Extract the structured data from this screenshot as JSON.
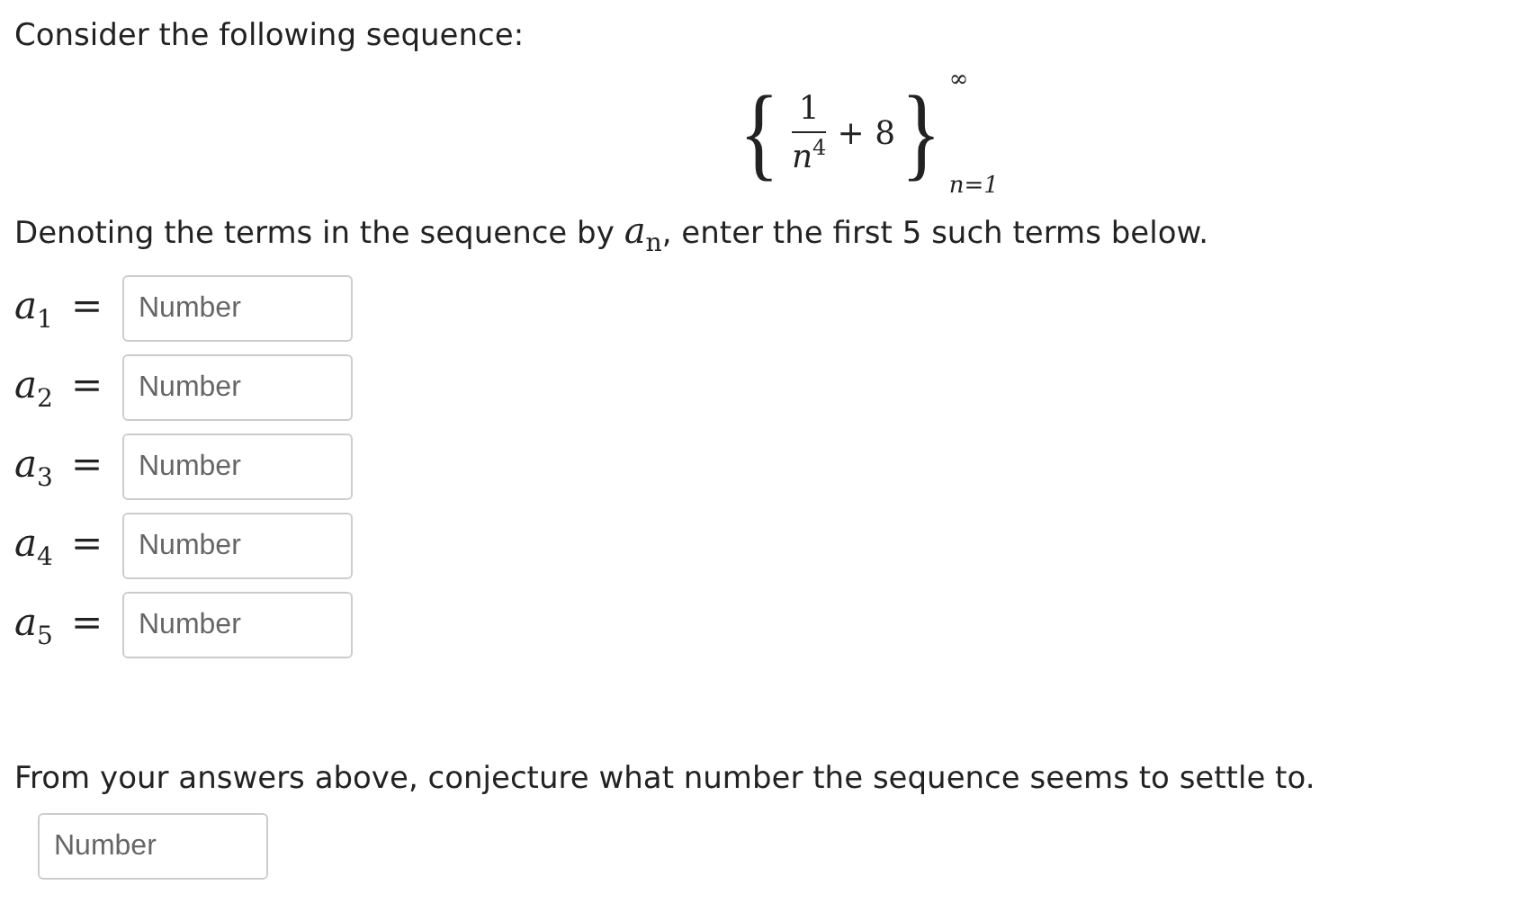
{
  "intro": "Consider the following sequence:",
  "formula": {
    "open": "{",
    "numerator": "1",
    "denominator_base": "n",
    "denominator_exp": "4",
    "addend": "+ 8",
    "close": "}",
    "upper": "∞",
    "lower": "n=1"
  },
  "instruction": "Denoting the terms in the sequence by *a*$_{n}$, enter the first 5 such terms below.",
  "terms": [
    {
      "symbol": "a",
      "index": "1",
      "equals": "=",
      "placeholder": "Number"
    },
    {
      "symbol": "a",
      "index": "2",
      "equals": "=",
      "placeholder": "Number"
    },
    {
      "symbol": "a",
      "index": "3",
      "equals": "=",
      "placeholder": "Number"
    },
    {
      "symbol": "a",
      "index": "4",
      "equals": "=",
      "placeholder": "Number"
    },
    {
      "symbol": "a",
      "index": "5",
      "equals": "=",
      "placeholder": "Number"
    }
  ],
  "question": "From your answers above, conjecture what number the sequence seems to settle to.",
  "answer": {
    "placeholder": "Number"
  }
}
